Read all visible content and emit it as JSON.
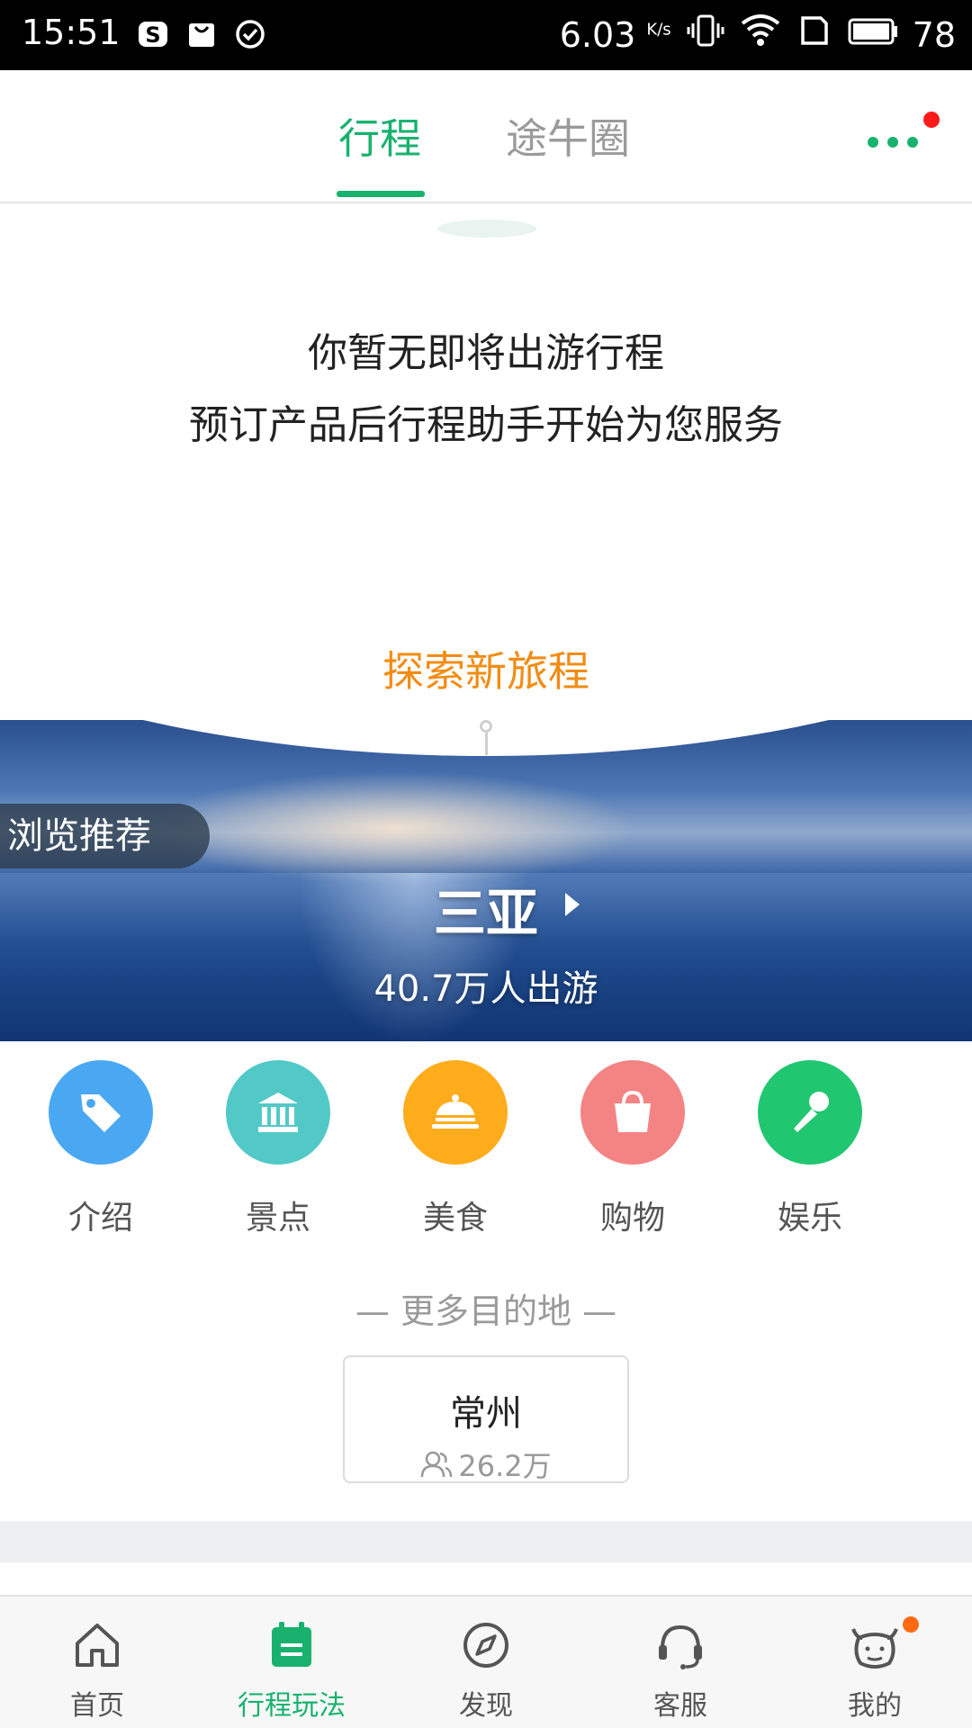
{
  "status_bar": {
    "time": "15:51",
    "net_speed": "6.03",
    "net_unit": "K/s",
    "battery": "78",
    "icons": [
      "sogou-icon",
      "bag-icon",
      "check-circle-icon",
      "vibrate-icon",
      "wifi-icon",
      "sim-icon",
      "battery-icon"
    ]
  },
  "top_tabs": [
    {
      "label": "行程",
      "active": true
    },
    {
      "label": "途牛圈",
      "active": false
    }
  ],
  "empty_state": {
    "line1": "你暂无即将出游行程",
    "line2": "预订产品后行程助手开始为您服务"
  },
  "explore": "探索新旅程",
  "banner": {
    "tag": "浏览推荐",
    "city": "三亚",
    "travelers": "40.7万人出游"
  },
  "categories": [
    {
      "label": "介绍",
      "color": "#4aa8f2",
      "icon": "tag-icon"
    },
    {
      "label": "景点",
      "color": "#52c9c6",
      "icon": "landmark-icon"
    },
    {
      "label": "美食",
      "color": "#ffac1c",
      "icon": "food-cloche-icon"
    },
    {
      "label": "购物",
      "color": "#f48383",
      "icon": "shopping-bag-icon"
    },
    {
      "label": "娱乐",
      "color": "#20c770",
      "icon": "microphone-icon"
    }
  ],
  "more_destinations": {
    "title": "— 更多目的地 —",
    "items": [
      {
        "name": "常州",
        "count": "26.2万"
      }
    ]
  },
  "bottom_nav": [
    {
      "label": "首页",
      "icon": "home-icon",
      "active": false
    },
    {
      "label": "行程玩法",
      "icon": "calendar-icon",
      "active": true
    },
    {
      "label": "发现",
      "icon": "compass-icon",
      "active": false
    },
    {
      "label": "客服",
      "icon": "headset-icon",
      "active": false
    },
    {
      "label": "我的",
      "icon": "cow-face-icon",
      "active": false,
      "badge": true
    }
  ],
  "colors": {
    "accent": "#18b26e",
    "explore": "#f28c14",
    "badge_red": "#ff1a1a",
    "badge_orange": "#ff6a13"
  }
}
